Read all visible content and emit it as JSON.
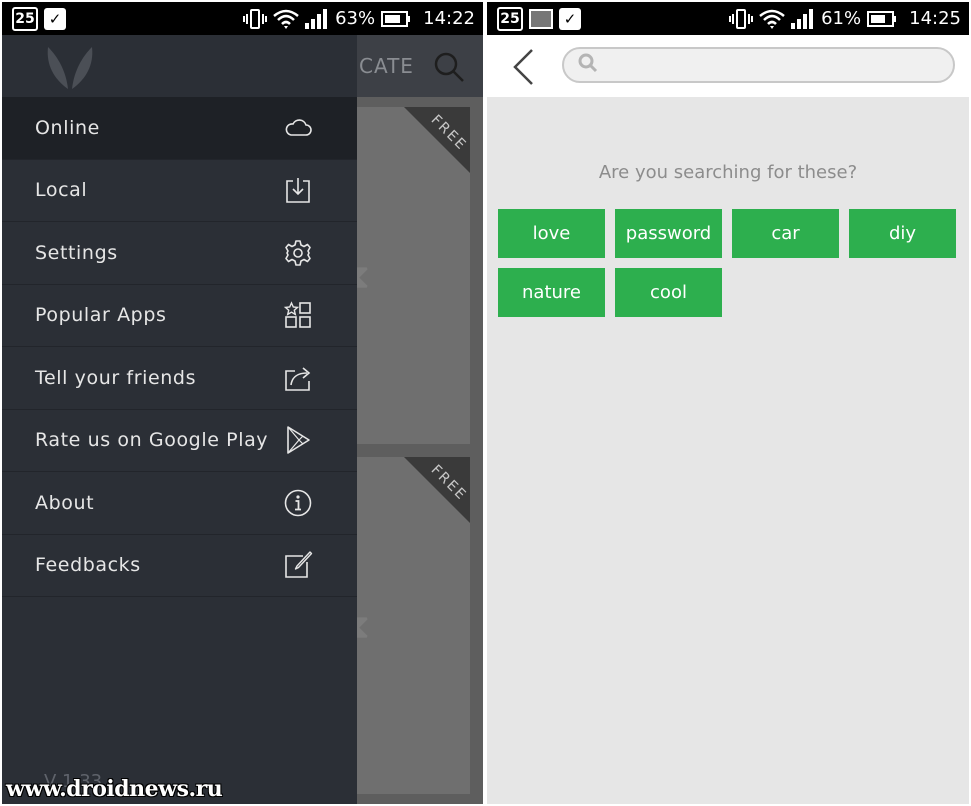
{
  "left_screen": {
    "status": {
      "calendar_day": "25",
      "battery": "63%",
      "time": "14:22"
    },
    "background": {
      "header_text": "CATE",
      "ribbon_label": "FREE"
    },
    "drawer": {
      "items": [
        {
          "label": "Online",
          "icon": "cloud-icon"
        },
        {
          "label": "Local",
          "icon": "download-icon"
        },
        {
          "label": "Settings",
          "icon": "gear-icon"
        },
        {
          "label": "Popular Apps",
          "icon": "apps-grid-icon"
        },
        {
          "label": "Tell your friends",
          "icon": "share-icon"
        },
        {
          "label": "Rate us on Google Play",
          "icon": "play-icon"
        },
        {
          "label": "About",
          "icon": "info-icon"
        },
        {
          "label": "Feedbacks",
          "icon": "edit-icon"
        }
      ],
      "version": "V 1.33"
    },
    "watermark": "www.droidnews.ru"
  },
  "right_screen": {
    "status": {
      "calendar_day": "25",
      "battery": "61%",
      "time": "14:25"
    },
    "search": {
      "placeholder": ""
    },
    "suggest_title": "Are you searching for these?",
    "tags": [
      "love",
      "password",
      "car",
      "diy",
      "nature",
      "cool"
    ],
    "colors": {
      "tag_green": "#2daf4e",
      "drawer_bg": "#2b2f36"
    }
  }
}
